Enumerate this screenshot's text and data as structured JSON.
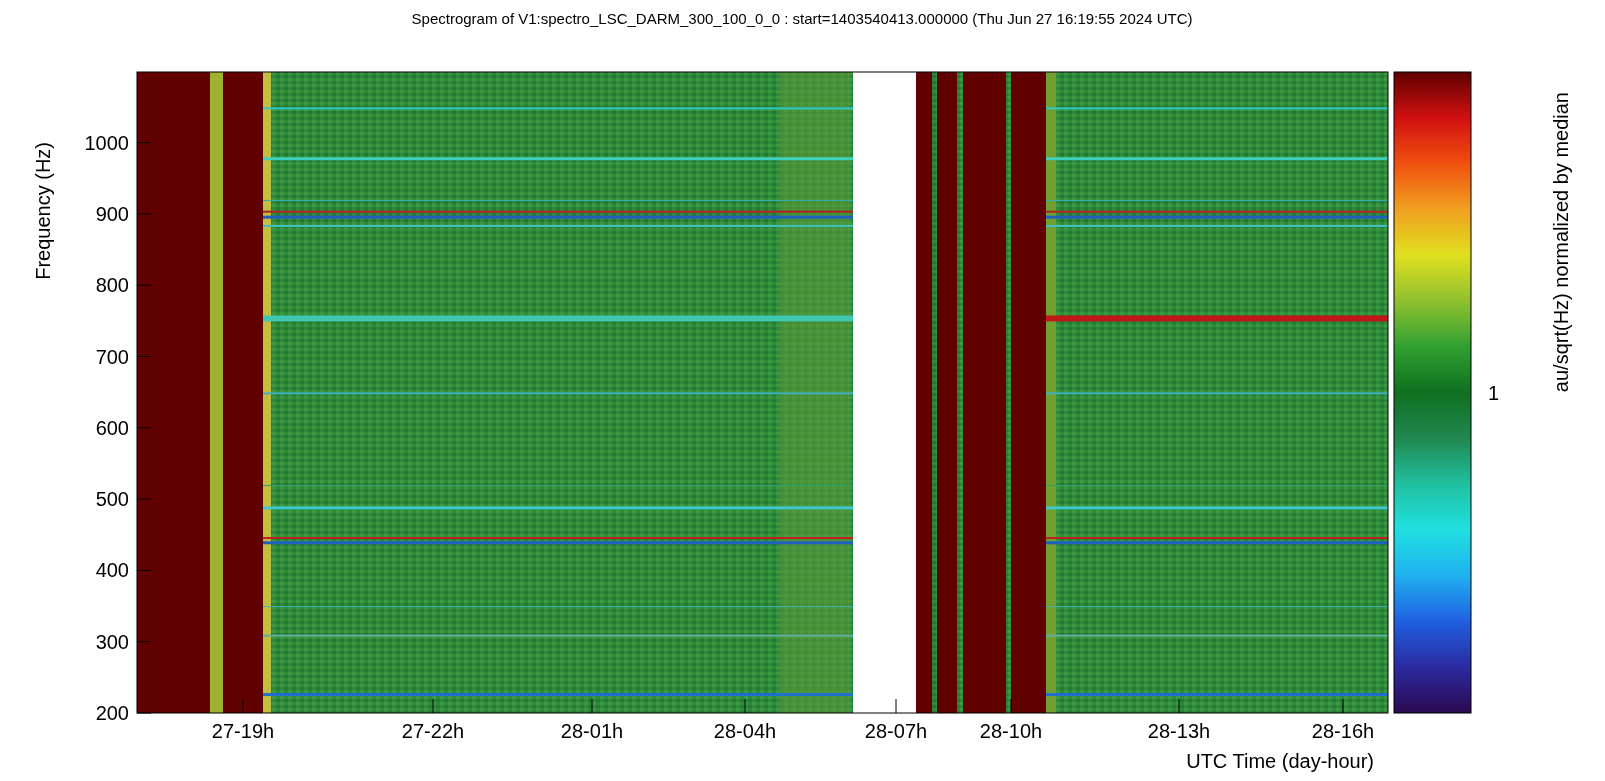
{
  "title": "Spectrogram of V1:spectro_LSC_DARM_300_100_0_0 : start=1403540413.000000 (Thu Jun 27 16:19:55 2024 UTC)",
  "ylabel": "Frequency (Hz)",
  "xlabel": "UTC Time (day-hour)",
  "yticks": [
    "1000",
    "900",
    "800",
    "700",
    "600",
    "500",
    "400",
    "300",
    "200"
  ],
  "xticks": [
    "27-19h",
    "27-22h",
    "28-01h",
    "28-04h",
    "28-07h",
    "28-10h",
    "28-13h",
    "28-16h"
  ],
  "colorbar_label": "au/sqrt(Hz) normalized by median",
  "colorbar_ticks": [
    "1"
  ]
}
